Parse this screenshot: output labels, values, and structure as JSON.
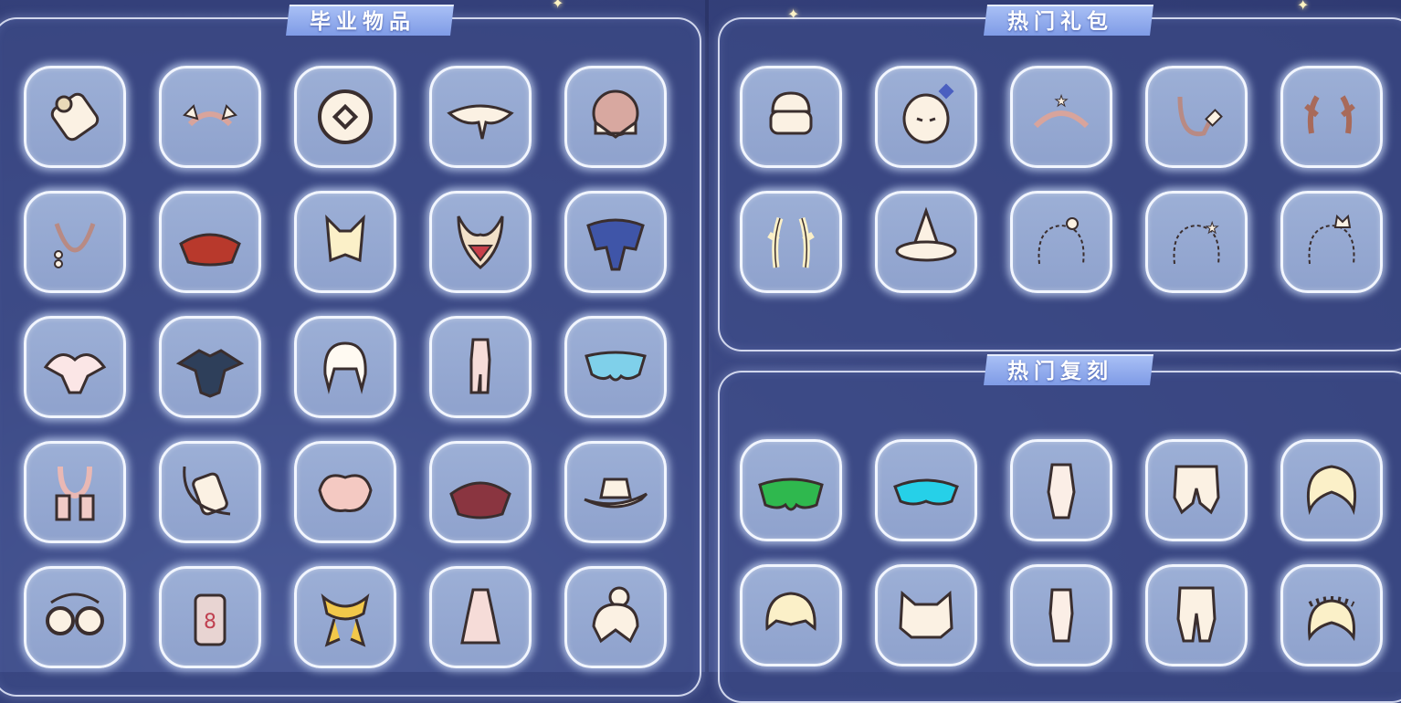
{
  "sections": {
    "graduation": {
      "title": "毕业物品"
    },
    "hot_packs": {
      "title": "热门礼包"
    },
    "hot_rerun": {
      "title": "热门复刻"
    }
  },
  "graduation_items": [
    "drum-icon",
    "winged-headband-icon",
    "round-medallion-icon",
    "white-cape-icon",
    "hood-mask-icon",
    "bead-necklace-icon",
    "red-cape-icon",
    "bunny-ears-hair-icon",
    "horned-mask-icon",
    "blue-cape-icon",
    "petal-cape-icon",
    "dark-armor-cape-icon",
    "white-hair-icon",
    "pink-outfit-icon",
    "butterfly-cape-icon",
    "scarf-icon",
    "satchel-icon",
    "shell-cape-icon",
    "maroon-cape-icon",
    "cowboy-hat-icon",
    "glasses-icon",
    "tag-pendant-icon",
    "golden-scarf-icon",
    "robe-outfit-icon",
    "bun-hair-icon"
  ],
  "hot_pack_items": [
    "fur-hat-icon",
    "moon-mask-icon",
    "star-headband-icon",
    "hook-necklace-icon",
    "antler-icon",
    "coral-horns-icon",
    "witch-hat-icon",
    "shell-hair-accessory-icon",
    "star-hair-accessory-icon",
    "cat-hair-accessory-icon"
  ],
  "hot_rerun_items": [
    "green-leaf-cape-icon",
    "cyan-wave-cape-icon",
    "long-coat-outfit-icon",
    "puffy-pants-icon",
    "wavy-hair-icon",
    "short-hair-icon",
    "cat-hood-icon",
    "small-outfit-icon",
    "knee-pants-icon",
    "flower-crown-hair-icon"
  ],
  "colors": {
    "background": "#34407a",
    "tile": "#9cafd6",
    "banner": "#8aa4ea",
    "icon_cream": "#fbf1e3",
    "icon_outline": "#3a2e2e"
  }
}
